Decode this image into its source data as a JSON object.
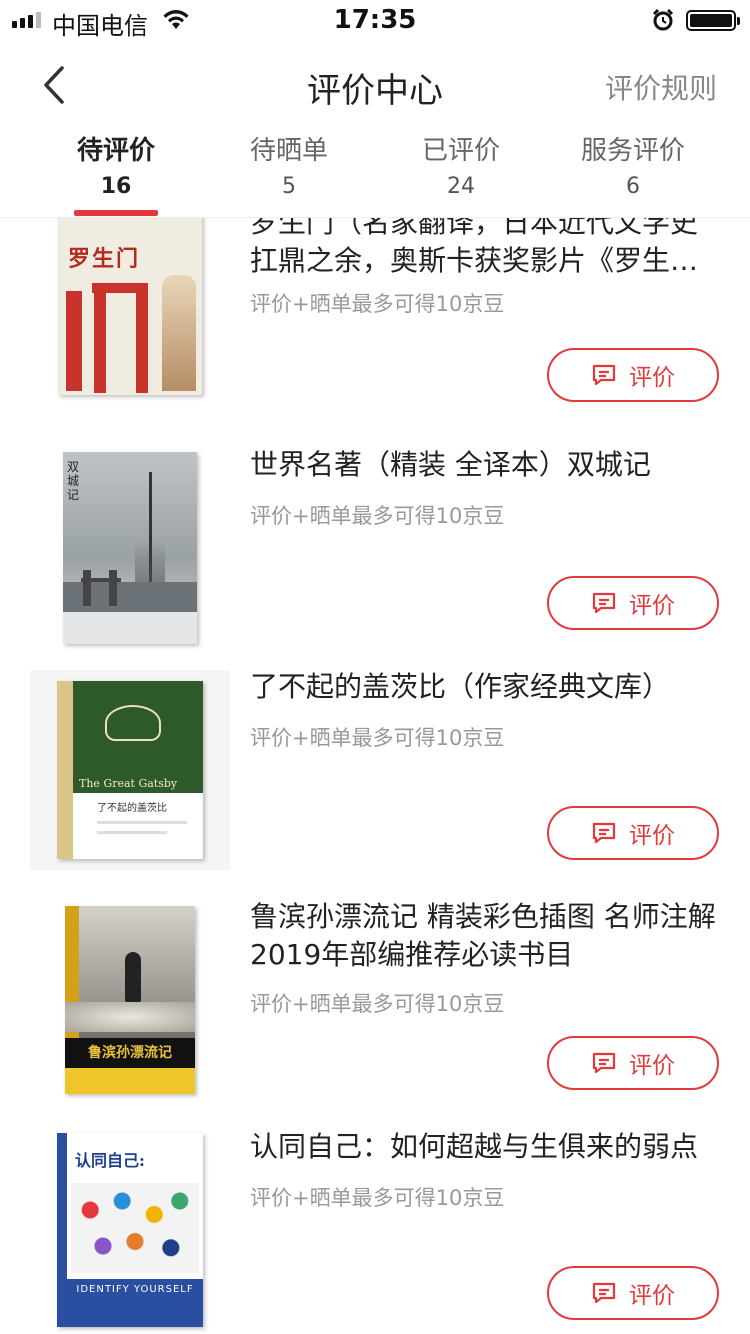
{
  "status_bar": {
    "carrier": "中国电信",
    "time": "17:35"
  },
  "nav": {
    "title": "评价中心",
    "rules": "评价规则"
  },
  "tabs": [
    {
      "label": "待评价",
      "count": "16",
      "active": true
    },
    {
      "label": "待晒单",
      "count": "5"
    },
    {
      "label": "已评价",
      "count": "24"
    },
    {
      "label": "服务评价",
      "count": "6"
    }
  ],
  "items": [
    {
      "title": "罗生门（名家翻译，日本近代文学史扛鼎之余，奥斯卡获奖影片《罗生门》原著）",
      "hint": "评价+晒单最多可得10京豆",
      "button": "评价",
      "cover_text": "罗生门"
    },
    {
      "title": "世界名著（精装 全译本）双城记",
      "hint": "评价+晒单最多可得10京豆",
      "button": "评价",
      "cover_text": "双城记"
    },
    {
      "title": "了不起的盖茨比（作家经典文库）",
      "hint": "评价+晒单最多可得10京豆",
      "button": "评价",
      "cover_text": "了不起的盖茨比",
      "cover_subtext": "The Great Gatsby"
    },
    {
      "title": "鲁滨孙漂流记 精装彩色插图 名师注解 2019年部编推荐必读书目",
      "hint": "评价+晒单最多可得10京豆",
      "button": "评价",
      "cover_text": "鲁滨孙漂流记"
    },
    {
      "title": "认同自己：如何超越与生俱来的弱点",
      "hint": "评价+晒单最多可得10京豆",
      "button": "评价",
      "cover_text": "认同自己:",
      "cover_subtext": "IDENTIFY YOURSELF"
    }
  ],
  "colors": {
    "accent": "#e4393c",
    "text": "#222222",
    "hint": "#999999"
  }
}
